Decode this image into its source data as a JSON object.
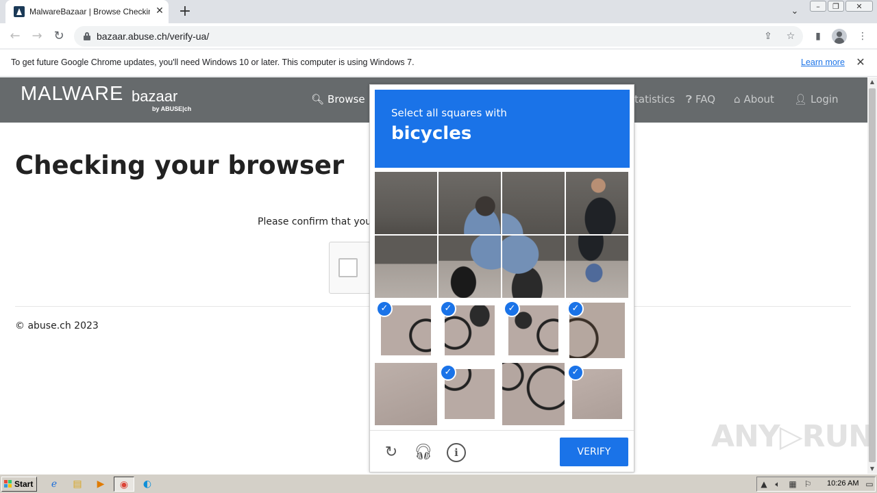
{
  "browser": {
    "tab_title": "MalwareBazaar | Browse Checking y",
    "tab_close": "✕",
    "new_tab": "+",
    "tab_search": "⌄",
    "url": "bazaar.abuse.ch/verify-ua/",
    "icons": [
      "back-arrow-icon",
      "forward-arrow-icon",
      "reload-icon",
      "lock-icon",
      "share-icon",
      "star-icon",
      "side-panel-icon",
      "profile-icon",
      "menu-dots-icon"
    ]
  },
  "infobar": {
    "message": "To get future Google Chrome updates, you'll need Windows 10 or later. This computer is using Windows 7.",
    "link": "Learn more",
    "close": "✕"
  },
  "site": {
    "logo_main": "MALWARE",
    "logo_sub": "bazaar",
    "logo_by": "by ABUSE|ch",
    "nav": {
      "browse": "Browse",
      "statistics": "tatistics",
      "faq": "FAQ",
      "about": "About",
      "login": "Login"
    }
  },
  "page": {
    "heading": "Checking your browser",
    "confirm_text": "Please confirm that you",
    "footer": "© abuse.ch 2023"
  },
  "challenge": {
    "prompt": "Select all squares with",
    "target": "bicycles",
    "verify_label": "VERIFY",
    "check_mark": "✓",
    "selected_tiles": [
      8,
      9,
      10,
      11,
      13,
      15
    ],
    "brand_color": "#1a73e8"
  },
  "watermark": "ANY▷RUN",
  "taskbar": {
    "start": "Start",
    "clock": "10:26 AM"
  }
}
